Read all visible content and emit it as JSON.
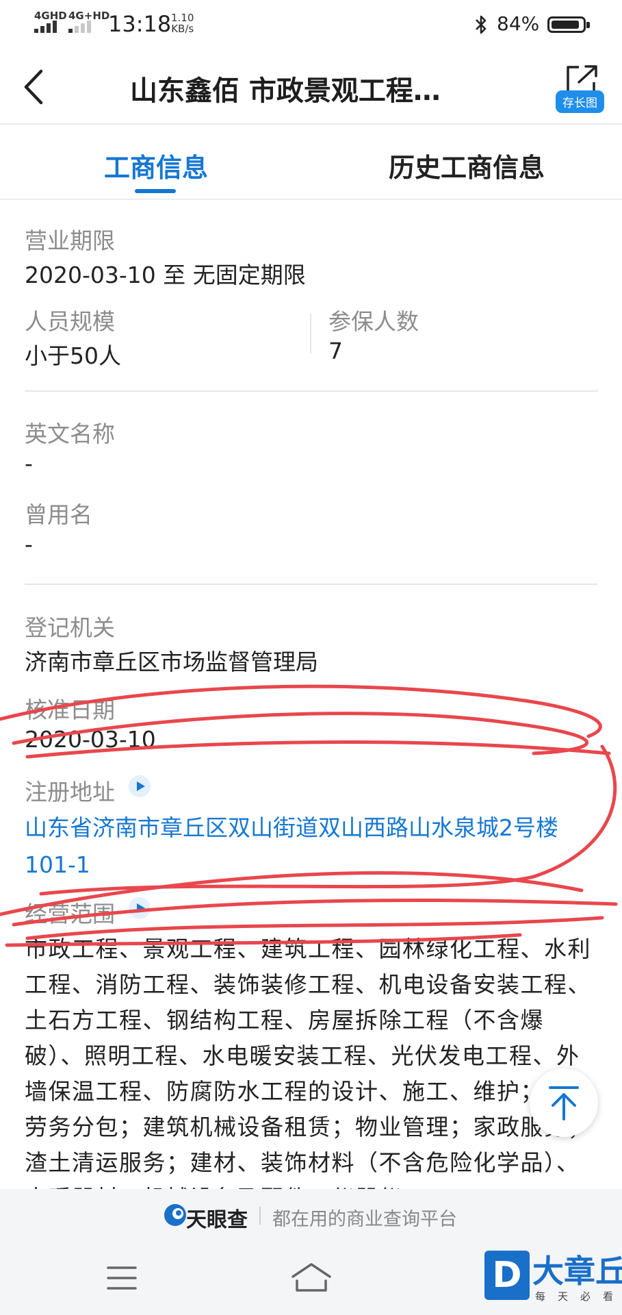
{
  "status_bar": {
    "net1": "4GHD",
    "net2": "4G+HD",
    "time": "13:18",
    "speed_value": "1.10",
    "speed_unit": "KB/s",
    "battery_pct": "84%"
  },
  "header": {
    "title": "山东鑫佰 市政景观工程…",
    "save_label": "存长图"
  },
  "tabs": [
    {
      "label": "工商信息",
      "active": true
    },
    {
      "label": "历史工商信息",
      "active": false
    }
  ],
  "fields": {
    "business_term": {
      "label": "营业期限",
      "value": "2020-03-10 至 无固定期限"
    },
    "staff_size": {
      "label": "人员规模",
      "value": "小于50人"
    },
    "insured_count": {
      "label": "参保人数",
      "value": "7"
    },
    "english_name": {
      "label": "英文名称",
      "value": "-"
    },
    "former_name": {
      "label": "曾用名",
      "value": "-"
    },
    "registration_authority": {
      "label": "登记机关",
      "value": "济南市章丘区市场监督管理局"
    },
    "approval_date": {
      "label": "核准日期",
      "value": "2020-03-10"
    },
    "registered_address": {
      "label": "注册地址",
      "value": "山东省济南市章丘区双山街道双山西路山水泉城2号楼101-1"
    },
    "business_scope": {
      "label": "经营范围",
      "value": "市政工程、景观工程、建筑工程、园林绿化工程、水利工程、消防工程、装饰装修工程、机电设备安装工程、土石方工程、钢结构工程、房屋拆除工程（不含爆破）、照明工程、水电暖安装工程、光伏发电工程、外墙保温工程、防腐防水工程的设计、施工、维护；建筑劳务分包；建筑机械设备租赁；物业管理；家政服务；渣土清运服务；建材、装饰材料（不含危险化学品）、水暖器材、机械设备及配件、仪器仪"
    }
  },
  "footer": {
    "brand_name": "天眼查",
    "slogan": "都在用的商业查询平台"
  },
  "watermark": {
    "logo_letter": "D",
    "name": "大章丘",
    "sub": "每天必看"
  },
  "colors": {
    "accent": "#1677d2",
    "scribble": "#e8474d"
  }
}
